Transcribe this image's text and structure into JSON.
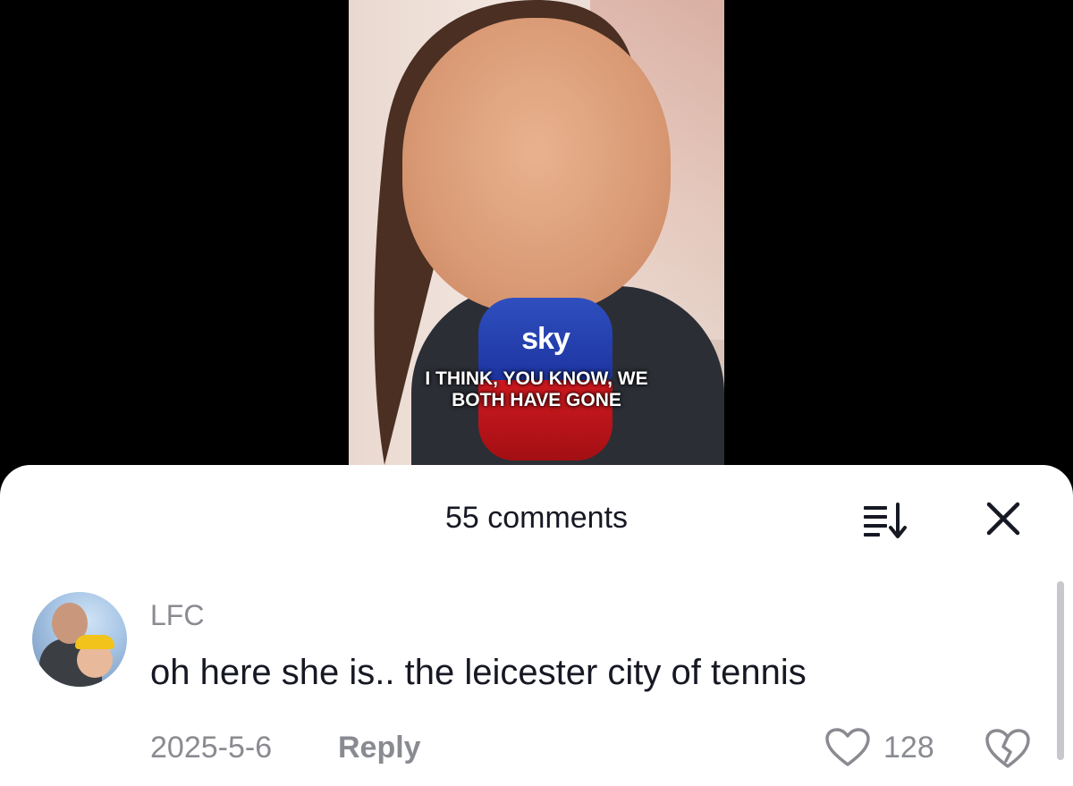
{
  "video": {
    "mic_logo": "sky",
    "caption_line1": "I THINK, YOU KNOW, WE",
    "caption_line2": "BOTH HAVE GONE"
  },
  "comments_panel": {
    "title": "55 comments",
    "sort_icon": "sort-list-icon",
    "close_icon": "close-icon"
  },
  "comments": [
    {
      "username": "LFC",
      "text": "oh here she is.. the leicester city of tennis",
      "date": "2025-5-6",
      "reply_label": "Reply",
      "likes": "128",
      "like_icon": "heart-outline-icon",
      "dislike_icon": "broken-heart-icon"
    }
  ],
  "colors": {
    "sheet_bg": "#ffffff",
    "text_primary": "#161823",
    "text_secondary": "#8a8b91"
  }
}
